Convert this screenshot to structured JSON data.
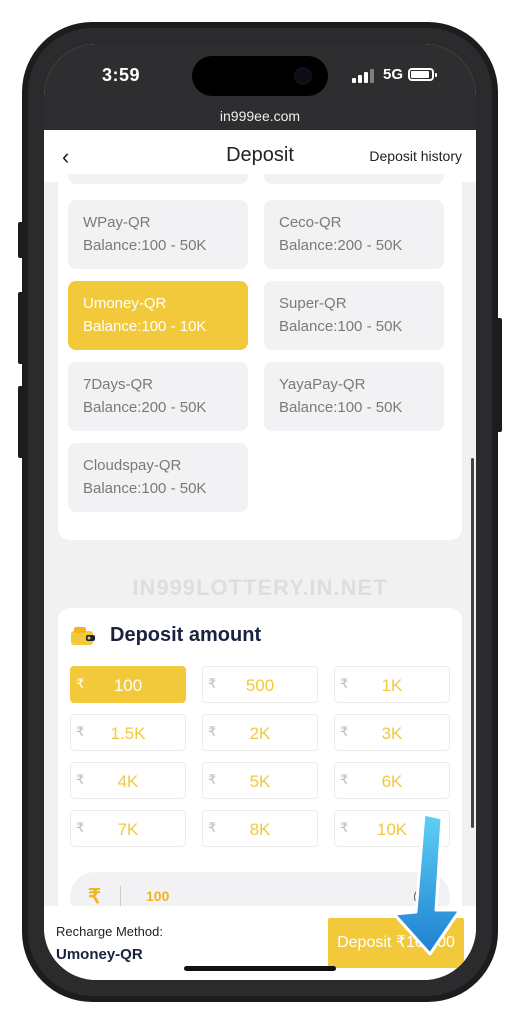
{
  "status": {
    "time": "3:59",
    "network": "5G"
  },
  "browser": {
    "url": "in999ee.com"
  },
  "header": {
    "back": "‹",
    "title": "Deposit",
    "history": "Deposit history"
  },
  "channels": [
    {
      "name": "WPay-QR",
      "balance": "Balance:100 - 50K",
      "selected": false
    },
    {
      "name": "Ceco-QR",
      "balance": "Balance:200 - 50K",
      "selected": false
    },
    {
      "name": "Umoney-QR",
      "balance": "Balance:100 - 10K",
      "selected": true
    },
    {
      "name": "Super-QR",
      "balance": "Balance:100 - 50K",
      "selected": false
    },
    {
      "name": "7Days-QR",
      "balance": "Balance:200 - 50K",
      "selected": false
    },
    {
      "name": "YayaPay-QR",
      "balance": "Balance:100 - 50K",
      "selected": false
    },
    {
      "name": "Cloudspay-QR",
      "balance": "Balance:100 - 50K",
      "selected": false
    }
  ],
  "watermark": "IN999LOTTERY.IN.NET",
  "deposit_amount": {
    "title": "Deposit amount",
    "currency": "₹",
    "options": [
      "100",
      "500",
      "1K",
      "1.5K",
      "2K",
      "3K",
      "4K",
      "5K",
      "6K",
      "7K",
      "8K",
      "10K"
    ],
    "selected": "100",
    "input_value": "100",
    "clear": "×"
  },
  "footer": {
    "method_label": "Recharge Method:",
    "method_value": "Umoney-QR",
    "button": "Deposit ₹100.00"
  },
  "colors": {
    "accent": "#f2c93a",
    "arrow": "#2a9be0"
  }
}
